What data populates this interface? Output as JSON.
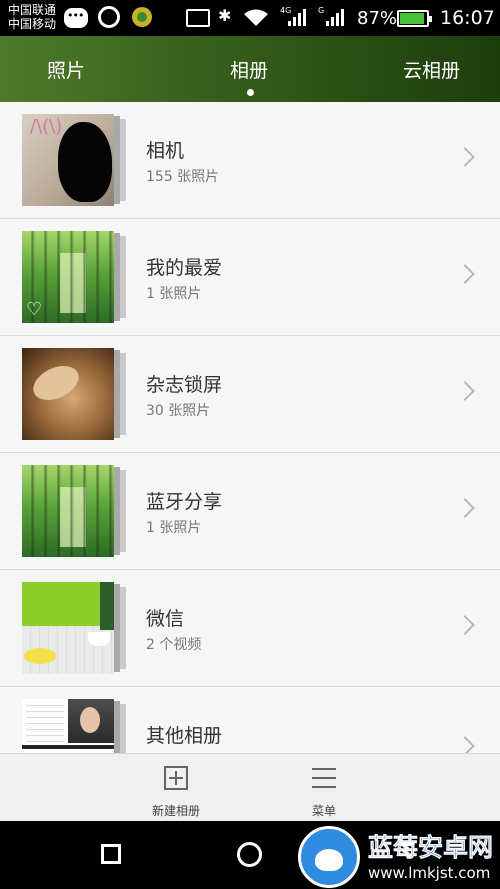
{
  "status_bar": {
    "carrier_1": "中国联通",
    "carrier_2": "中国移动",
    "signal_1_tag": "4G",
    "signal_2_tag": "G",
    "battery": "87%",
    "time": "16:07"
  },
  "tabs": [
    {
      "label": "照片"
    },
    {
      "label": "相册"
    },
    {
      "label": "云相册"
    }
  ],
  "albums": [
    {
      "title": "相机",
      "subtitle": "155 张照片"
    },
    {
      "title": "我的最爱",
      "subtitle": "1 张照片"
    },
    {
      "title": "杂志锁屏",
      "subtitle": "30 张照片"
    },
    {
      "title": "蓝牙分享",
      "subtitle": "1 张照片"
    },
    {
      "title": "微信",
      "subtitle": "2 个视频"
    },
    {
      "title": "其他相册",
      "subtitle": ""
    }
  ],
  "toolbar": {
    "new_album_label": "新建相册",
    "menu_label": "菜单"
  },
  "watermark": {
    "name": "蓝莓安卓网",
    "url": "www.lmkjst.com"
  },
  "colors": {
    "header_start": "#4f7a2b",
    "header_end": "#1e3d0d",
    "battery_fill": "#49c43a",
    "watermark_blue": "#1a6ed0"
  }
}
